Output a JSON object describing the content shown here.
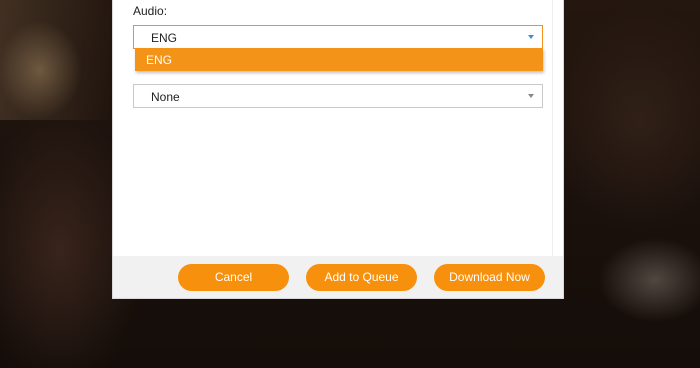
{
  "audio": {
    "label": "Audio:",
    "selected": "ENG",
    "options": [
      "ENG"
    ]
  },
  "subtitle": {
    "selected": "None"
  },
  "buttons": {
    "cancel": "Cancel",
    "add_to_queue": "Add to Queue",
    "download_now": "Download Now"
  },
  "colors": {
    "accent": "#f7900c",
    "dropdown_highlight": "#f39318",
    "focus_border": "#f5901e",
    "arrow": "#3d8fd6"
  },
  "icons": {
    "audio_dropdown": "chevron-down-icon",
    "subtitle_dropdown": "chevron-down-icon"
  }
}
